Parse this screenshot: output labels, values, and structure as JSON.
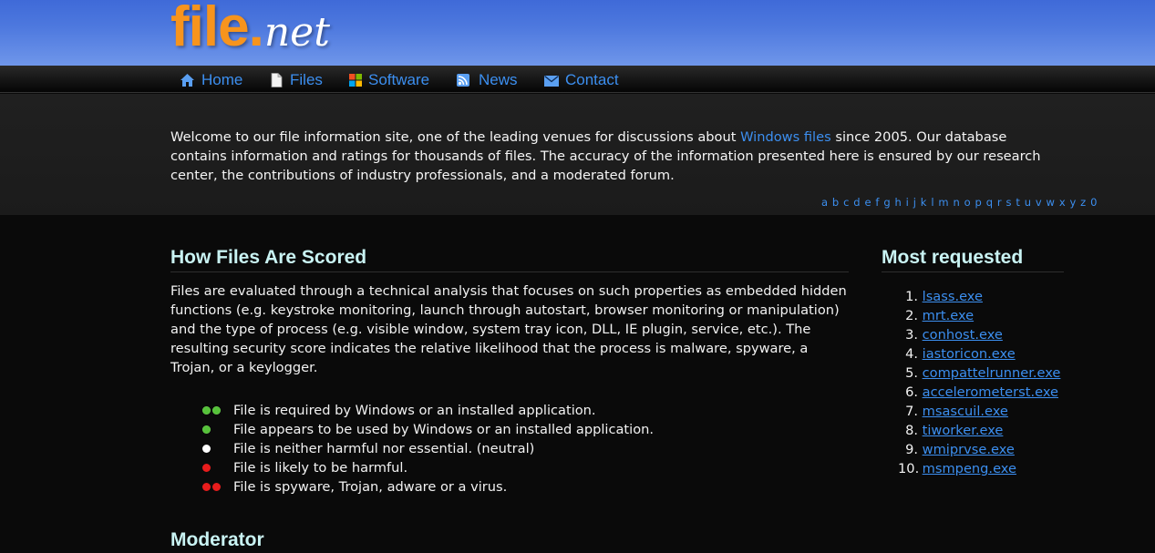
{
  "logo": {
    "file": "file",
    "dot": ".",
    "net": "net"
  },
  "nav": {
    "items": [
      {
        "label": "Home",
        "icon": "home-icon"
      },
      {
        "label": "Files",
        "icon": "document-icon"
      },
      {
        "label": "Software",
        "icon": "windows-icon"
      },
      {
        "label": "News",
        "icon": "rss-icon"
      },
      {
        "label": "Contact",
        "icon": "mail-icon"
      }
    ]
  },
  "intro": {
    "text_before": "Welcome to our file information site, one of the leading venues for discussions about ",
    "link": "Windows files",
    "text_after": " since 2005. Our database contains information and ratings for thousands of files. The accuracy of the information presented here is ensured by our research center, the contributions of industry professionals, and a moderated forum.",
    "alphabet": [
      "a",
      "b",
      "c",
      "d",
      "e",
      "f",
      "g",
      "h",
      "i",
      "j",
      "k",
      "l",
      "m",
      "n",
      "o",
      "p",
      "q",
      "r",
      "s",
      "t",
      "u",
      "v",
      "w",
      "x",
      "y",
      "z",
      "0"
    ]
  },
  "scoring": {
    "heading": "How Files Are Scored",
    "body": "Files are evaluated through a technical analysis that focuses on such properties as embedded hidden functions (e.g. keystroke monitoring, launch through autostart, browser monitoring or manipulation) and the type of process (e.g. visible window, system tray icon, DLL, IE plugin, service, etc.). The resulting security score indicates the relative likelihood that the process is malware, spyware, a Trojan, or a keylogger.",
    "legend": [
      {
        "text": "File is required by Windows or an installed application."
      },
      {
        "text": "File appears to be used by Windows or an installed application."
      },
      {
        "text": "File is neither harmful nor essential. (neutral)"
      },
      {
        "text": "File is likely to be harmful."
      },
      {
        "text": "File is spyware, Trojan, adware or a virus."
      }
    ]
  },
  "moderator": {
    "heading": "Moderator"
  },
  "most_requested": {
    "heading": "Most requested",
    "items": [
      {
        "num": "1.",
        "name": "lsass.exe"
      },
      {
        "num": "2.",
        "name": "mrt.exe"
      },
      {
        "num": "3.",
        "name": "conhost.exe"
      },
      {
        "num": "4.",
        "name": "iastoricon.exe"
      },
      {
        "num": "5.",
        "name": "compattelrunner.exe"
      },
      {
        "num": "6.",
        "name": "accelerometerst.exe"
      },
      {
        "num": "7.",
        "name": "msascuil.exe"
      },
      {
        "num": "8.",
        "name": "tiworker.exe"
      },
      {
        "num": "9.",
        "name": "wmiprvse.exe"
      },
      {
        "num": "10.",
        "name": "msmpeng.exe"
      }
    ]
  },
  "colors": {
    "link": "#3c8ff0",
    "heading": "#c9f3f3",
    "logo_orange": "#f7941d",
    "header_blue": "#4d78de",
    "green_dot": "#56c23a",
    "red_dot": "#e81c1c"
  }
}
